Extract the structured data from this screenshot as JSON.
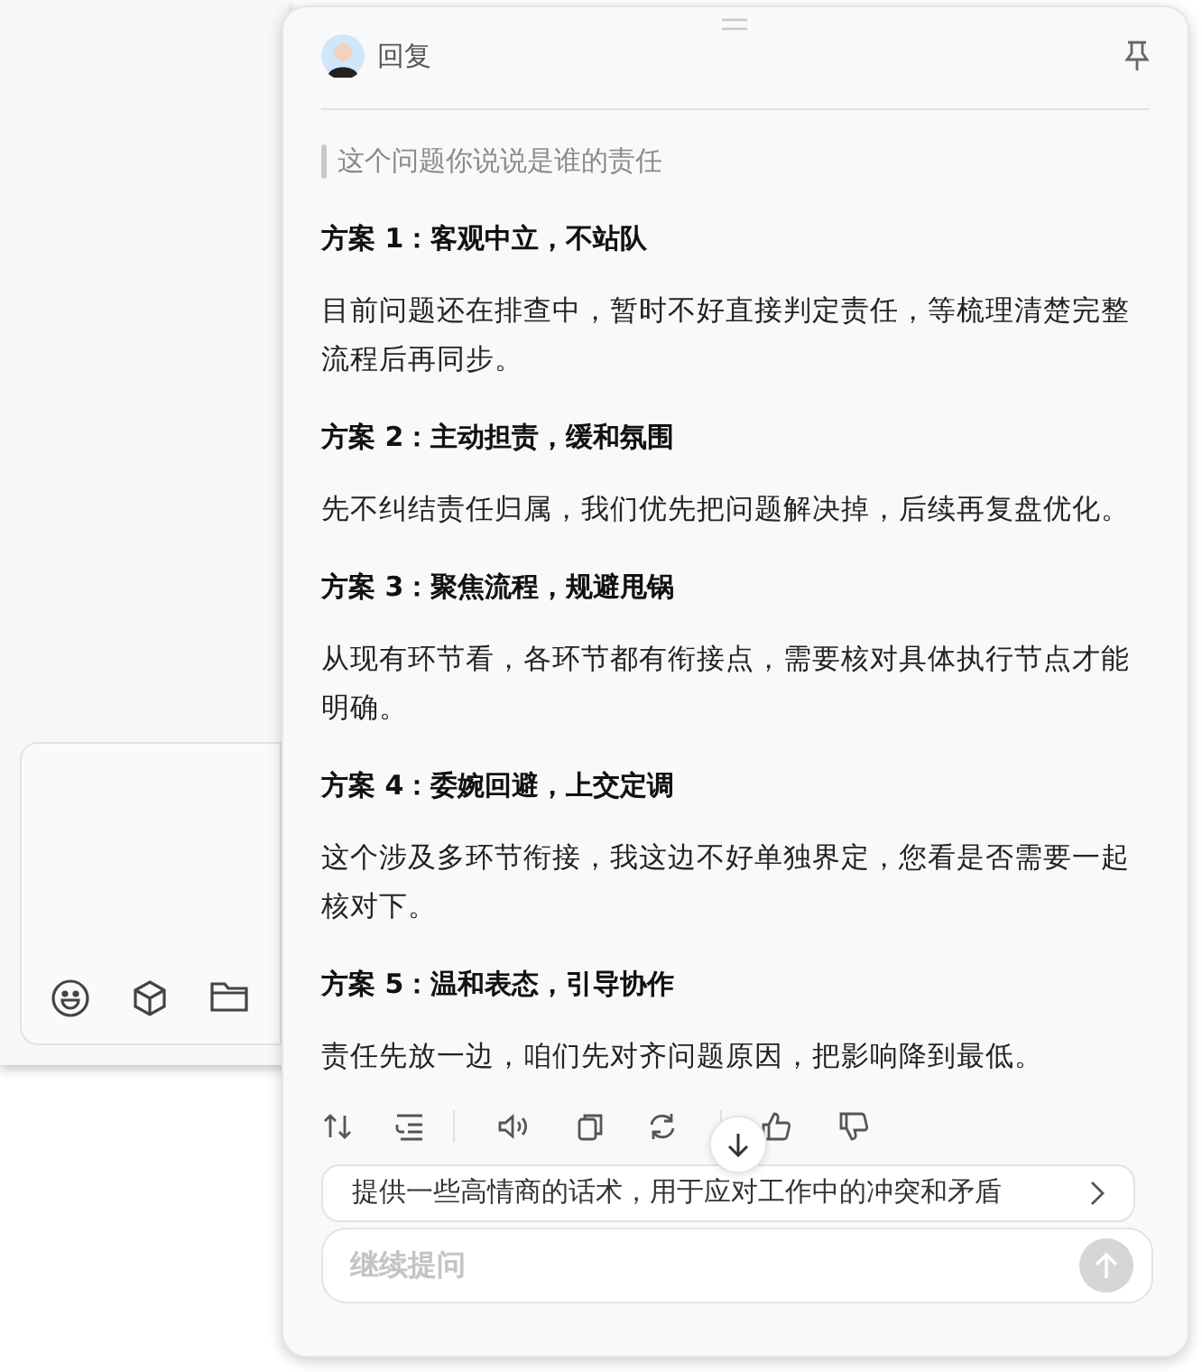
{
  "header": {
    "title": "回复",
    "pinned": false
  },
  "quote": "这个问题你说说是谁的责任",
  "sections": [
    {
      "title": "方案 1：客观中立，不站队",
      "body": "目前问题还在排查中，暂时不好直接判定责任，等梳理清楚完整流程后再同步。"
    },
    {
      "title": "方案 2：主动担责，缓和氛围",
      "body": "先不纠结责任归属，我们优先把问题解决掉，后续再复盘优化。"
    },
    {
      "title": "方案 3：聚焦流程，规避甩锅",
      "body": "从现有环节看，各环节都有衔接点，需要核对具体执行节点才能明确。"
    },
    {
      "title": "方案 4：委婉回避，上交定调",
      "body": "这个涉及多环节衔接，我这边不好单独界定，您看是否需要一起核对下。"
    },
    {
      "title": "方案 5：温和表态，引导协作",
      "body": "责任先放一边，咱们先对齐问题原因，把影响降到最低。"
    }
  ],
  "suggestion": "提供一些高情商的话术，用于应对工作中的冲突和矛盾",
  "input": {
    "placeholder": "继续提问",
    "send_disabled": true
  }
}
